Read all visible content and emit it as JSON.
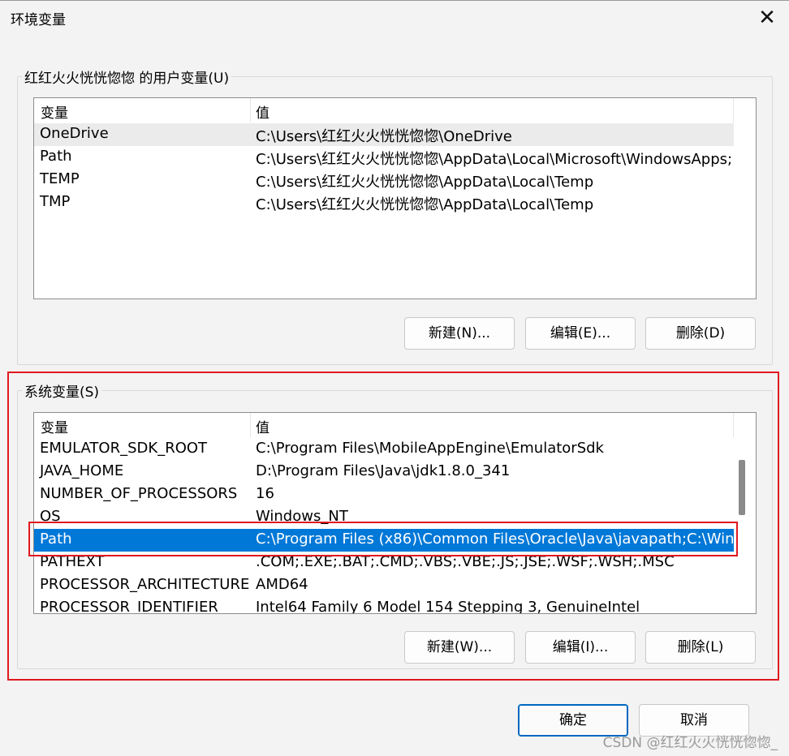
{
  "window": {
    "title": "环境变量"
  },
  "user_vars": {
    "label": "红红火火恍恍惚惚 的用户变量(U)",
    "col_name": "变量",
    "col_value": "值",
    "rows": [
      {
        "name": "OneDrive",
        "value": "C:\\Users\\红红火火恍恍惚惚\\OneDrive"
      },
      {
        "name": "Path",
        "value": "C:\\Users\\红红火火恍恍惚惚\\AppData\\Local\\Microsoft\\WindowsApps;"
      },
      {
        "name": "TEMP",
        "value": "C:\\Users\\红红火火恍恍惚惚\\AppData\\Local\\Temp"
      },
      {
        "name": "TMP",
        "value": "C:\\Users\\红红火火恍恍惚惚\\AppData\\Local\\Temp"
      }
    ],
    "buttons": {
      "new": "新建(N)...",
      "edit": "编辑(E)...",
      "delete": "删除(D)"
    }
  },
  "system_vars": {
    "label": "系统变量(S)",
    "col_name": "变量",
    "col_value": "值",
    "rows": [
      {
        "name": "EMULATOR_SDK_ROOT",
        "value": "C:\\Program Files\\MobileAppEngine\\EmulatorSdk"
      },
      {
        "name": "JAVA_HOME",
        "value": "D:\\Program Files\\Java\\jdk1.8.0_341"
      },
      {
        "name": "NUMBER_OF_PROCESSORS",
        "value": "16"
      },
      {
        "name": "OS",
        "value": "Windows_NT"
      },
      {
        "name": "Path",
        "value": "C:\\Program Files (x86)\\Common Files\\Oracle\\Java\\javapath;C:\\Win..."
      },
      {
        "name": "PATHEXT",
        "value": ".COM;.EXE;.BAT;.CMD;.VBS;.VBE;.JS;.JSE;.WSF;.WSH;.MSC"
      },
      {
        "name": "PROCESSOR_ARCHITECTURE",
        "value": "AMD64"
      },
      {
        "name": "PROCESSOR_IDENTIFIER",
        "value": "Intel64 Family 6 Model 154 Stepping 3, GenuineIntel"
      }
    ],
    "selected_row": "Path",
    "buttons": {
      "new": "新建(W)...",
      "edit": "编辑(I)...",
      "delete": "删除(L)"
    }
  },
  "footer": {
    "ok": "确定",
    "cancel": "取消"
  },
  "watermark": "CSDN @红红火火恍恍惚惚_",
  "colors": {
    "selection": "#0078d7",
    "annotation": "#e0181f"
  },
  "icons": {
    "close": "close-icon"
  }
}
